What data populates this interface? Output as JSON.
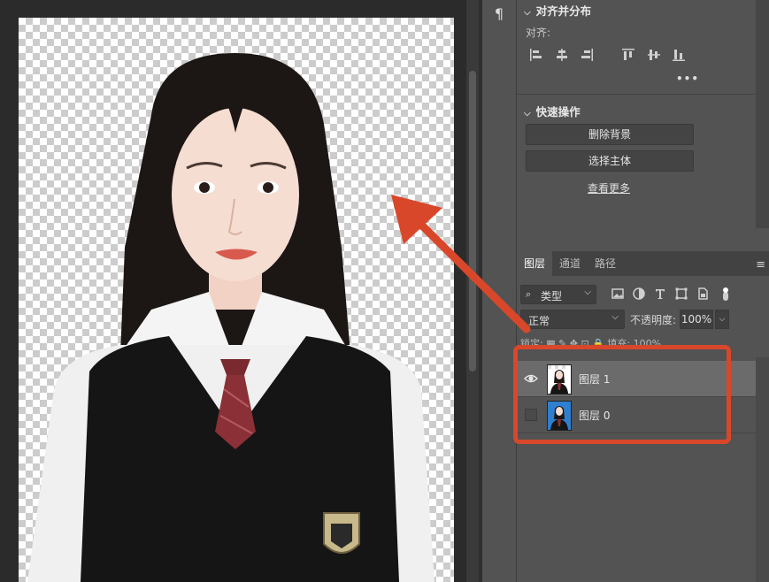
{
  "toolbar": {
    "paragraph_icon": "¶"
  },
  "align_panel": {
    "title": "对齐并分布",
    "align_label": "对齐:",
    "icons": [
      "align-left-icon",
      "align-hcenter-icon",
      "align-right-icon",
      "align-top-icon",
      "align-vcenter-icon",
      "align-bottom-icon"
    ],
    "more": "•••"
  },
  "quick_actions": {
    "title": "快速操作",
    "remove_bg": "删除背景",
    "select_subject": "选择主体",
    "see_more": "查看更多"
  },
  "layers_panel": {
    "tabs": [
      {
        "label": "图层",
        "active": true
      },
      {
        "label": "通道",
        "active": false
      },
      {
        "label": "路径",
        "active": false
      }
    ],
    "filter": "类型",
    "blend_mode": "正常",
    "opacity_label": "不透明度:",
    "opacity_value": "100%",
    "lock_row": "锁定: ▦ ✎ ✥ ⊡ 🔒  填充: 100%",
    "layers": [
      {
        "name": "图层 1",
        "visible": true,
        "selected": true
      },
      {
        "name": "图层 0",
        "visible": false,
        "selected": false
      }
    ]
  },
  "colors": {
    "annotation": "#d9472b",
    "panel_bg": "#535353",
    "canvas_bg": "#2b2b2b"
  }
}
